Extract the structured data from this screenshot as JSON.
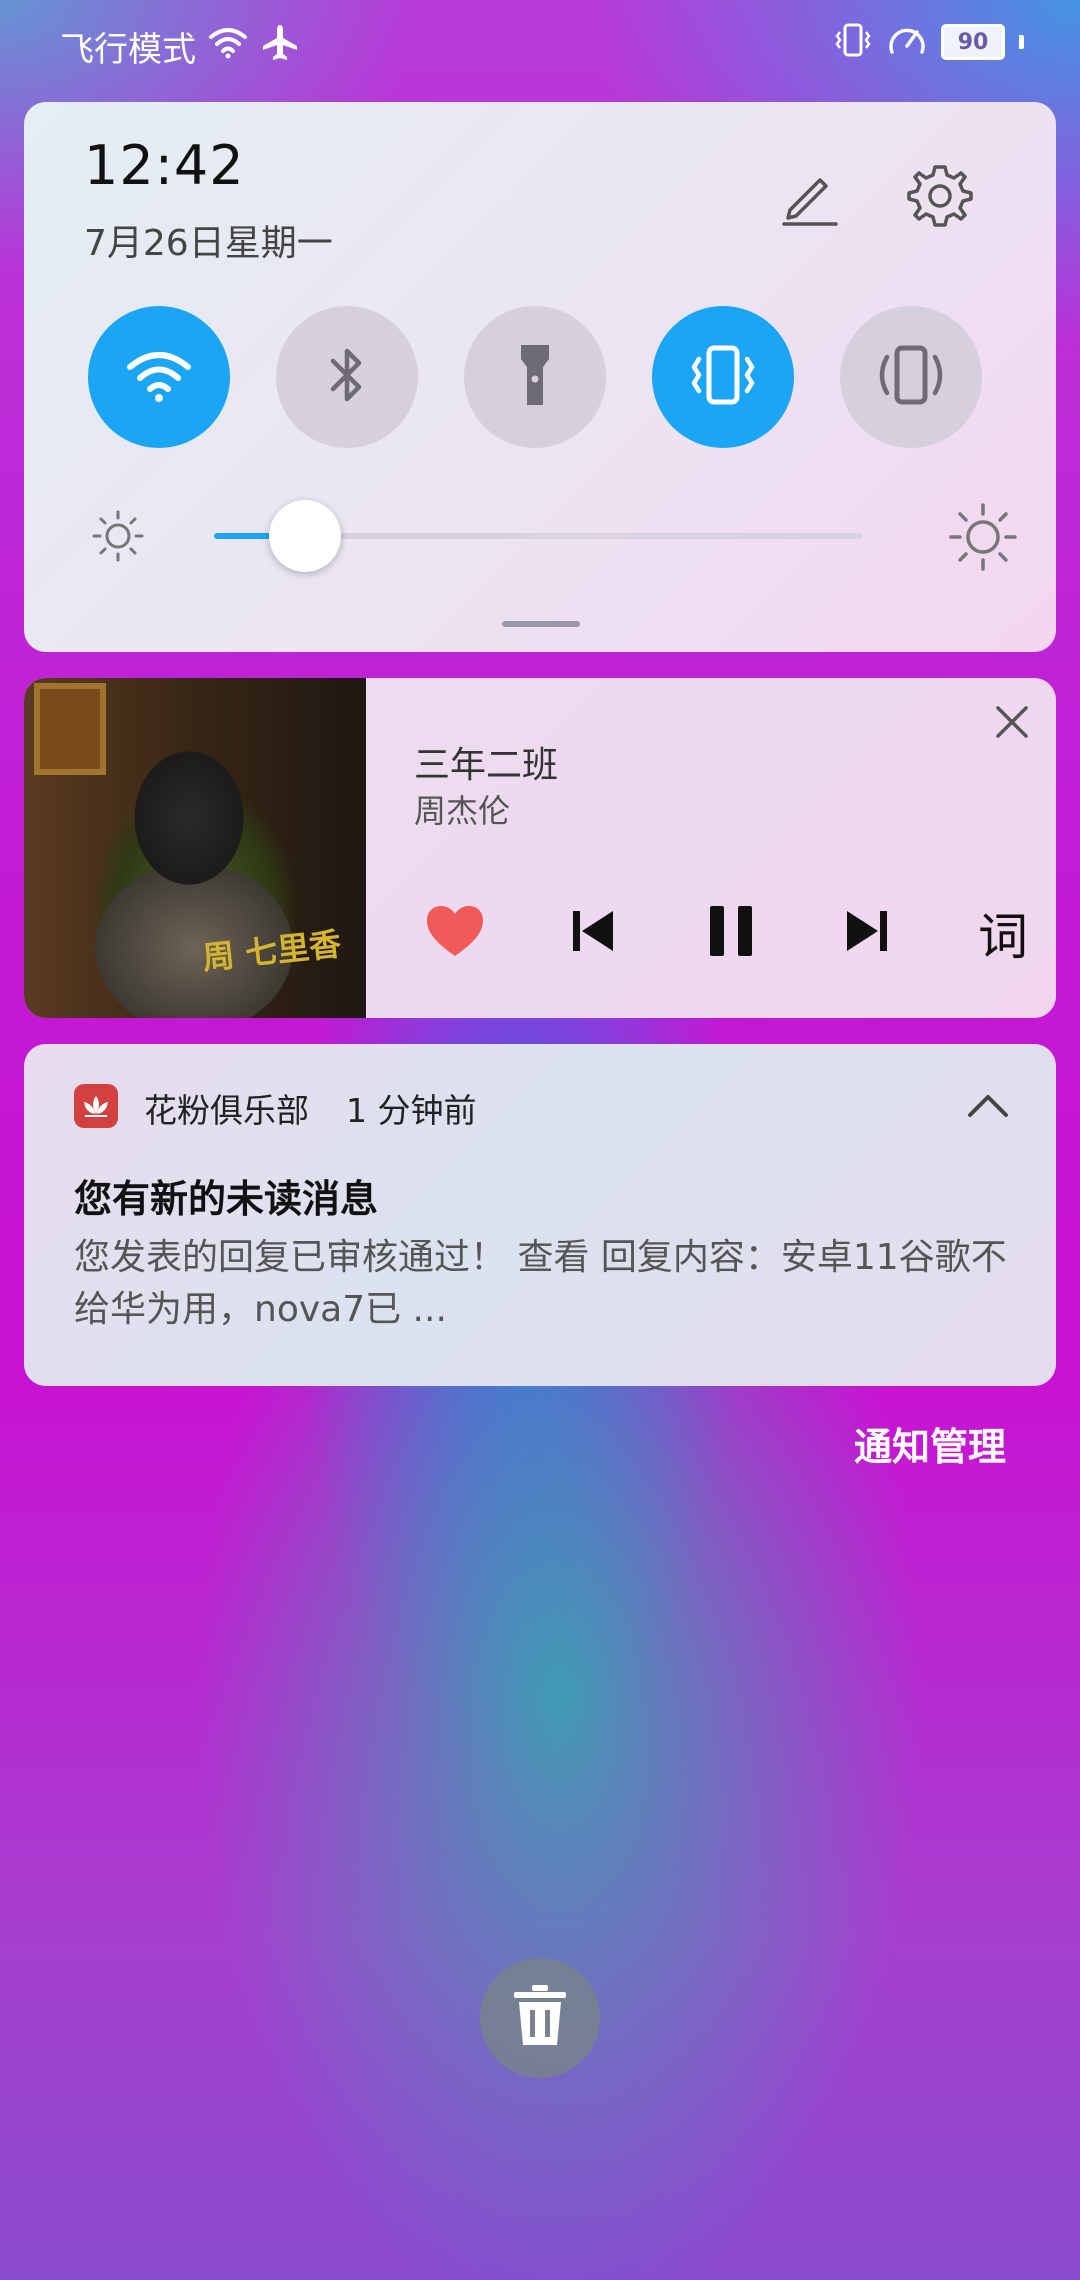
{
  "status_bar": {
    "mode_text": "飞行模式",
    "battery_level": "90",
    "icons": [
      "wifi-icon",
      "airplane-icon",
      "vibrate-icon",
      "speed-icon",
      "battery-icon"
    ]
  },
  "quick_settings": {
    "time": "12:42",
    "date": "7月26日星期一",
    "edit_icon": "pencil-icon",
    "settings_icon": "gear-icon",
    "toggles": [
      {
        "name": "wifi",
        "icon": "wifi-icon",
        "on": true
      },
      {
        "name": "bluetooth",
        "icon": "bluetooth-icon",
        "on": false
      },
      {
        "name": "flashlight",
        "icon": "flashlight-icon",
        "on": false
      },
      {
        "name": "vibrate",
        "icon": "vibrate-icon",
        "on": true
      },
      {
        "name": "auto-rotate",
        "icon": "rotate-icon",
        "on": false
      }
    ],
    "brightness_fraction": 0.14,
    "accent_color": "#1aa6f4"
  },
  "media": {
    "song_title": "三年二班",
    "artist": "周杰伦",
    "album_art_text": "周 七里香",
    "lyrics_button": "词",
    "liked": true,
    "like_color": "#f25a5a"
  },
  "notification": {
    "app_name": "花粉俱乐部",
    "time_ago": "1 分钟前",
    "title": "您有新的未读消息",
    "body": "您发表的回复已审核通过！  查看  回复内容：安卓11谷歌不给华为用，nova7已 ..."
  },
  "manage_label": "通知管理"
}
